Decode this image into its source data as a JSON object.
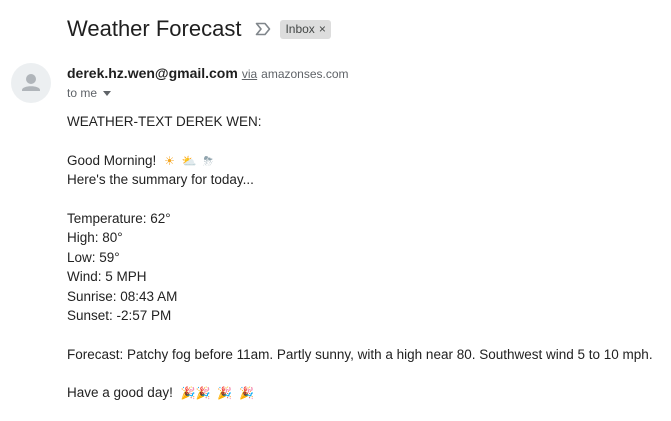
{
  "email": {
    "subject": "Weather Forecast",
    "label": "Inbox",
    "label_close": "×",
    "sender": {
      "email": "derek.hz.wen@gmail.com",
      "via_label": "via",
      "via_domain": "amazonses.com"
    },
    "recipient": "to me",
    "body": {
      "header": "WEATHER-TEXT DEREK WEN:",
      "greeting": "Good Morning!",
      "greeting_emojis": [
        "☀",
        "⛅",
        "⛈"
      ],
      "summary_intro": "Here's the summary for today...",
      "temperature": "Temperature: 62°",
      "high": "High: 80°",
      "low": "Low: 59°",
      "wind": "Wind: 5 MPH",
      "sunrise": "Sunrise: 08:43 AM",
      "sunset": "Sunset: -2:57 PM",
      "forecast": "Forecast: Patchy fog before 11am. Partly sunny, with a high near 80. Southwest wind 5 to 10 mph.",
      "signoff": "Have a good day!",
      "signoff_emojis": [
        "🎉🎉",
        "🎉",
        "🎉"
      ]
    }
  },
  "icons": {
    "importance": "importance-marker-icon",
    "avatar": "default-avatar-icon",
    "caret": "chevron-down-icon",
    "emoji": "party-popper-icon"
  },
  "colors": {
    "label_bg": "#dddddd",
    "avatar_bg": "#eceff1",
    "muted_text": "#5f6368"
  }
}
